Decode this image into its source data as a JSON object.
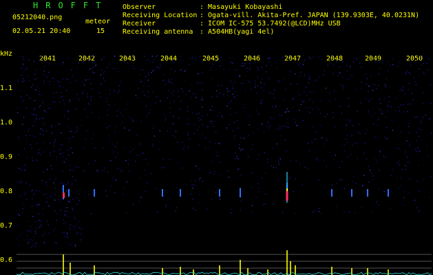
{
  "header": {
    "app_title": "HROFFT",
    "filename": "05212040.png",
    "datetime": "02.05.21 20:40",
    "meteor_label": "meteor",
    "meteor_count": "15",
    "info_labels": [
      "Observer",
      "Receiving Location",
      "Receiver",
      "Receiving antenna"
    ],
    "info_values": [
      ": Masayuki Kobayashi",
      ": Ogata-vill. Akita-Pref. JAPAN (139.9303E, 40.0231N)",
      ": ICOM IC-575 53.7492(@LCD)MHz USB",
      ": A504HB(yagi 4el)"
    ]
  },
  "axis": {
    "unit": "kHz",
    "time_ticks": [
      "2041",
      "2042",
      "2043",
      "2044",
      "2045",
      "2046",
      "2047",
      "2048",
      "2049",
      "2050"
    ],
    "freq_ticks": [
      "1.1",
      "1.0",
      "0.9",
      "0.8",
      "0.7",
      "0.6"
    ]
  },
  "colors": {
    "title": "#2ee62e",
    "axis_text": "#ffff00",
    "noise": "#1c1ca8",
    "background": "#000000"
  }
}
